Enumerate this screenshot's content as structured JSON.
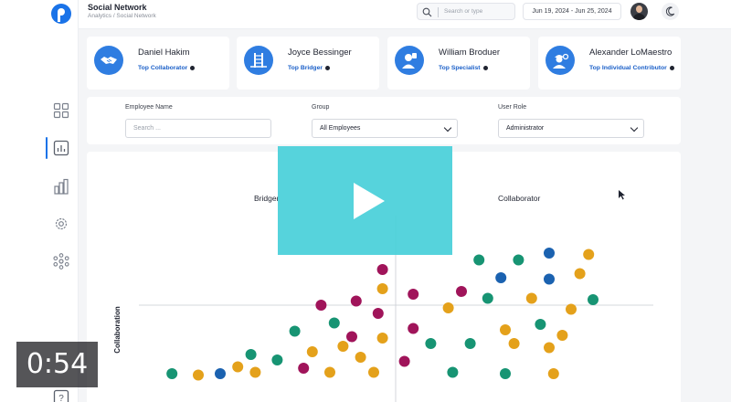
{
  "header": {
    "title": "Social Network",
    "breadcrumb": "Analytics / Social Network",
    "search_placeholder": "Search or type",
    "date_range": "Jun 19, 2024 - Jun 25, 2024"
  },
  "sidebar": {
    "items": [
      {
        "icon": "grid-icon"
      },
      {
        "icon": "chart-icon",
        "active": true
      },
      {
        "icon": "bar-chart-icon"
      },
      {
        "icon": "gear-icon"
      },
      {
        "icon": "network-icon"
      },
      {
        "icon": "help-icon"
      }
    ]
  },
  "cards": [
    {
      "name": "Daniel Hakim",
      "role": "Top Collaborator",
      "icon": "handshake-icon"
    },
    {
      "name": "Joyce Bessinger",
      "role": "Top Bridger",
      "icon": "bridge-icon"
    },
    {
      "name": "William Broduer",
      "role": "Top Specialist",
      "icon": "specialist-icon"
    },
    {
      "name": "Alexander LoMaestro",
      "role": "Top Individual Contributor",
      "icon": "worker-icon"
    }
  ],
  "filters": {
    "employee_label": "Employee Name",
    "employee_placeholder": "Search ...",
    "group_label": "Group",
    "group_value": "All Employees",
    "role_label": "User Role",
    "role_value": "Administrator"
  },
  "colors": {
    "green": "#179473",
    "orange": "#e4a11b",
    "purple": "#a0145a",
    "blue": "#1b62b0",
    "accent": "#1a73e8",
    "overlay": "#48cfd9"
  },
  "chart_data": {
    "type": "scatter",
    "ylabel": "Collaboration",
    "quadrant_labels": [
      "Bridger",
      "Collaborator"
    ],
    "color_groups": [
      "green",
      "orange",
      "purple",
      "blue"
    ],
    "points": [
      {
        "x": 0.04,
        "y": 0.02,
        "g": "green"
      },
      {
        "x": 0.1,
        "y": 0.01,
        "g": "orange"
      },
      {
        "x": 0.15,
        "y": 0.02,
        "g": "blue"
      },
      {
        "x": 0.19,
        "y": 0.07,
        "g": "orange"
      },
      {
        "x": 0.22,
        "y": 0.16,
        "g": "green"
      },
      {
        "x": 0.23,
        "y": 0.03,
        "g": "orange"
      },
      {
        "x": 0.28,
        "y": 0.12,
        "g": "green"
      },
      {
        "x": 0.32,
        "y": 0.33,
        "g": "green"
      },
      {
        "x": 0.34,
        "y": 0.06,
        "g": "purple"
      },
      {
        "x": 0.36,
        "y": 0.18,
        "g": "orange"
      },
      {
        "x": 0.38,
        "y": 0.52,
        "g": "purple"
      },
      {
        "x": 0.4,
        "y": 0.03,
        "g": "orange"
      },
      {
        "x": 0.41,
        "y": 0.39,
        "g": "green"
      },
      {
        "x": 0.43,
        "y": 0.22,
        "g": "orange"
      },
      {
        "x": 0.45,
        "y": 0.29,
        "g": "purple"
      },
      {
        "x": 0.46,
        "y": 0.55,
        "g": "purple"
      },
      {
        "x": 0.47,
        "y": 0.14,
        "g": "orange"
      },
      {
        "x": 0.5,
        "y": 0.03,
        "g": "orange"
      },
      {
        "x": 0.51,
        "y": 0.46,
        "g": "purple"
      },
      {
        "x": 0.52,
        "y": 0.64,
        "g": "orange"
      },
      {
        "x": 0.52,
        "y": 0.28,
        "g": "orange"
      },
      {
        "x": 0.52,
        "y": 0.78,
        "g": "purple"
      },
      {
        "x": 0.57,
        "y": 0.11,
        "g": "purple"
      },
      {
        "x": 0.59,
        "y": 0.6,
        "g": "purple"
      },
      {
        "x": 0.59,
        "y": 0.35,
        "g": "purple"
      },
      {
        "x": 0.63,
        "y": 0.24,
        "g": "green"
      },
      {
        "x": 0.67,
        "y": 0.5,
        "g": "orange"
      },
      {
        "x": 0.68,
        "y": 0.03,
        "g": "green"
      },
      {
        "x": 0.7,
        "y": 0.62,
        "g": "purple"
      },
      {
        "x": 0.72,
        "y": 0.24,
        "g": "green"
      },
      {
        "x": 0.74,
        "y": 0.85,
        "g": "green"
      },
      {
        "x": 0.76,
        "y": 0.57,
        "g": "green"
      },
      {
        "x": 0.79,
        "y": 0.72,
        "g": "blue"
      },
      {
        "x": 0.8,
        "y": 0.34,
        "g": "orange"
      },
      {
        "x": 0.8,
        "y": 0.02,
        "g": "green"
      },
      {
        "x": 0.82,
        "y": 0.24,
        "g": "orange"
      },
      {
        "x": 0.83,
        "y": 0.85,
        "g": "green"
      },
      {
        "x": 0.86,
        "y": 0.57,
        "g": "orange"
      },
      {
        "x": 0.88,
        "y": 0.38,
        "g": "green"
      },
      {
        "x": 0.9,
        "y": 0.21,
        "g": "orange"
      },
      {
        "x": 0.9,
        "y": 0.71,
        "g": "blue"
      },
      {
        "x": 0.9,
        "y": 0.9,
        "g": "blue"
      },
      {
        "x": 0.91,
        "y": 0.02,
        "g": "orange"
      },
      {
        "x": 0.93,
        "y": 0.3,
        "g": "orange"
      },
      {
        "x": 0.95,
        "y": 0.49,
        "g": "orange"
      },
      {
        "x": 0.97,
        "y": 0.75,
        "g": "orange"
      },
      {
        "x": 0.99,
        "y": 0.89,
        "g": "orange"
      },
      {
        "x": 1.0,
        "y": 0.56,
        "g": "green"
      }
    ]
  },
  "video": {
    "duration": "0:54"
  }
}
